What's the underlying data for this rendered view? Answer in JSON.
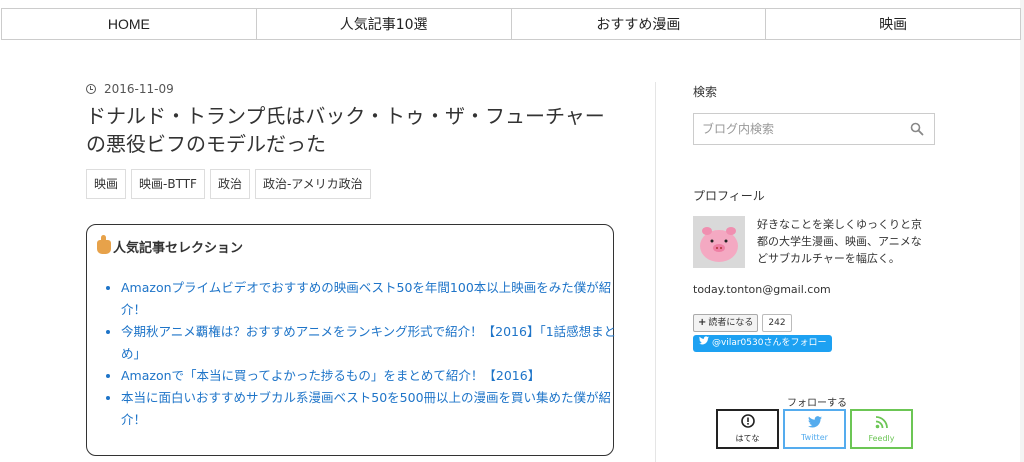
{
  "nav": {
    "items": [
      {
        "label": "HOME"
      },
      {
        "label": "人気記事10選"
      },
      {
        "label": "おすすめ漫画"
      },
      {
        "label": "映画"
      }
    ]
  },
  "article": {
    "date": "2016-11-09",
    "title": "ドナルド・トランプ氏はバック・トゥ・ザ・フューチャーの悪役ビフのモデルだった",
    "tags": [
      "映画",
      "映画-BTTF",
      "政治",
      "政治-アメリカ政治"
    ]
  },
  "popular": {
    "heading": "人気記事セレクション",
    "items": [
      "Amazonプライムビデオでおすすめの映画ベスト50を年間100本以上映画をみた僕が紹介！",
      "今期秋アニメ覇権は？おすすめアニメをランキング形式で紹介！【2016】「1話感想まとめ」",
      "Amazonで「本当に買ってよかった捗るもの」をまとめて紹介！【2016】",
      "本当に面白いおすすめサブカル系漫画ベスト50を500冊以上の漫画を買い集めた僕が紹介！"
    ]
  },
  "sidebar": {
    "search_heading": "検索",
    "search_placeholder": "ブログ内検索",
    "profile_heading": "プロフィール",
    "bio": "好きなことを楽しくゆっくりと京都の大学生漫画、映画、アニメなどサブカルチャーを幅広く。",
    "email": "today.tonton@gmail.com",
    "reader_label": "読者になる",
    "reader_count": "242",
    "twitter_follow": "@vilar0530さんをフォロー",
    "follow_heading": "フォローする",
    "follow_buttons": [
      {
        "label": "はてな"
      },
      {
        "label": "Twitter"
      },
      {
        "label": "Feedly"
      }
    ]
  },
  "colors": {
    "link": "#1e74c8",
    "twitter": "#55acee",
    "feedly": "#6cc655",
    "twitter_button": "#1da1f2"
  }
}
